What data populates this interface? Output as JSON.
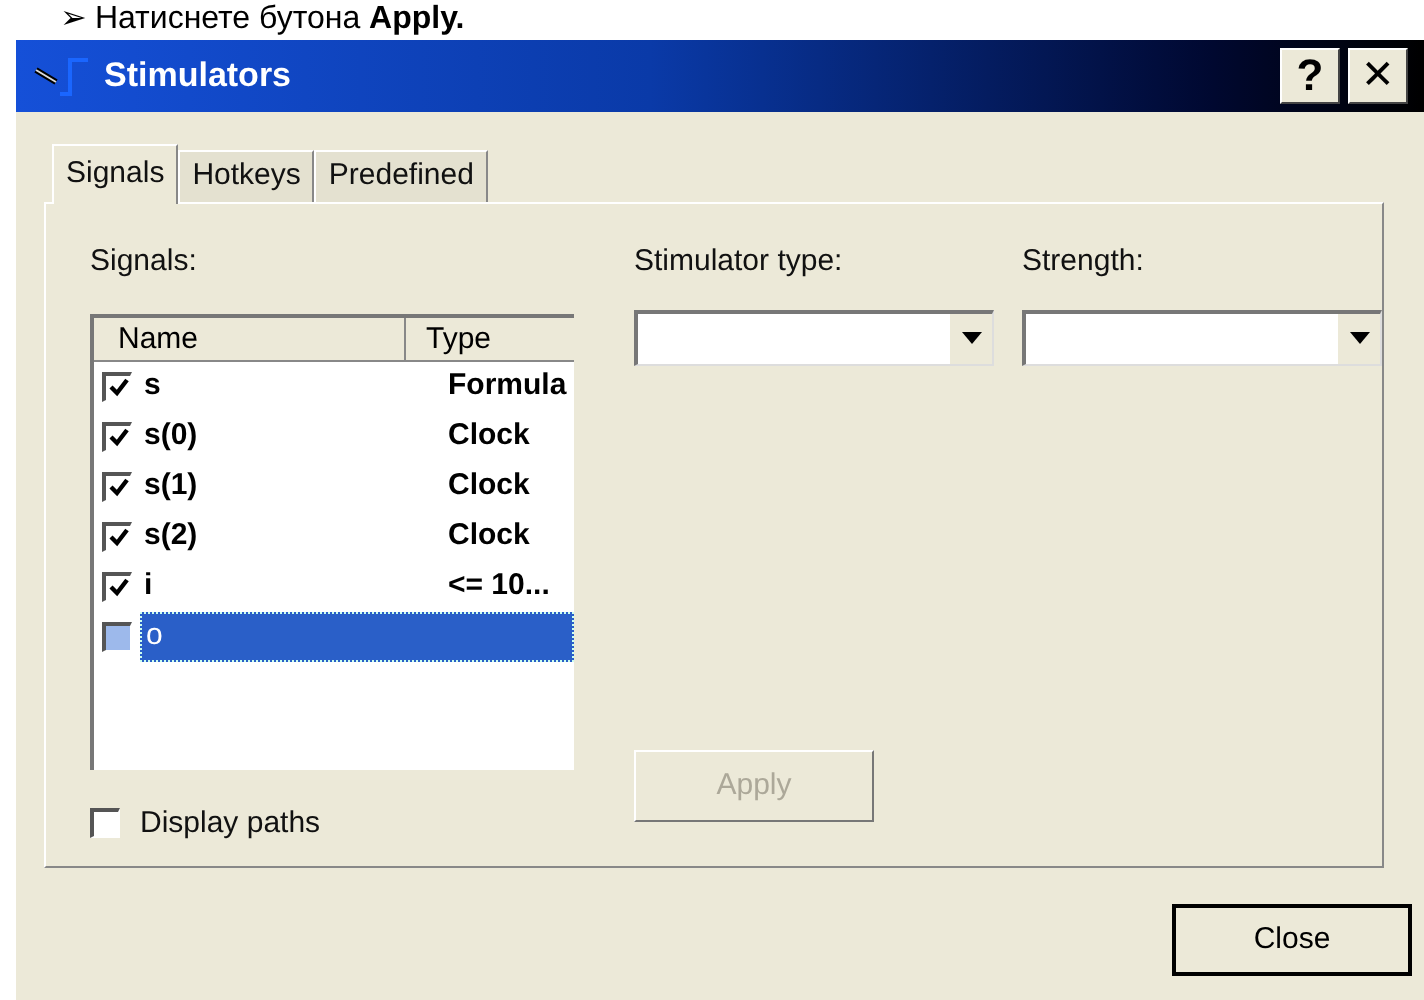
{
  "caption": "➢ Натиснете бутона **Apply.**",
  "window": {
    "title": "Stimulators",
    "help_button": "?",
    "close_button": "✕"
  },
  "tabs": [
    {
      "label": "Signals",
      "selected": true
    },
    {
      "label": "Hotkeys",
      "selected": false
    },
    {
      "label": "Predefined",
      "selected": false
    }
  ],
  "signals": {
    "label": "Signals:",
    "columns": [
      "Name",
      "Type"
    ],
    "rows": [
      {
        "name": "s",
        "type": "Formula",
        "checked": true,
        "selected": false
      },
      {
        "name": "s(0)",
        "type": "Clock",
        "checked": true,
        "selected": false
      },
      {
        "name": "s(1)",
        "type": "Clock",
        "checked": true,
        "selected": false
      },
      {
        "name": "s(2)",
        "type": "Clock",
        "checked": true,
        "selected": false
      },
      {
        "name": "i",
        "type": "<= 10...",
        "checked": true,
        "selected": false
      },
      {
        "name": "o",
        "checked": false,
        "selected": true
      }
    ]
  },
  "display_paths": {
    "label": "Display paths",
    "checked": false
  },
  "stimulator_type": {
    "label": "Stimulator type:"
  },
  "strength": {
    "label": "Strength:"
  },
  "apply_button": {
    "label": "Apply",
    "disabled": true
  },
  "close": {
    "label": "Close"
  }
}
